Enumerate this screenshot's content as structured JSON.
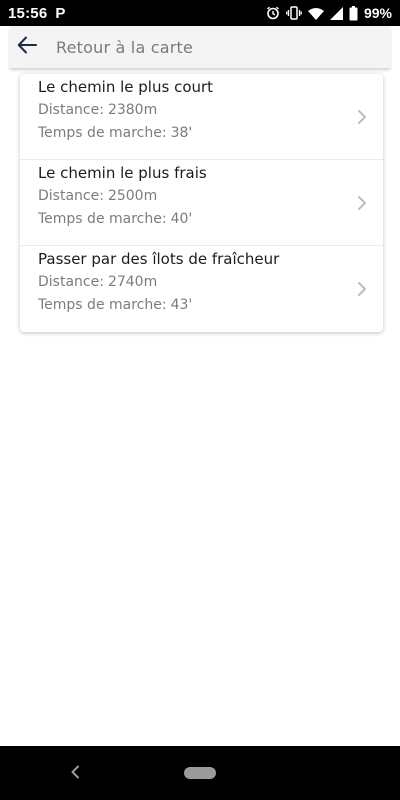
{
  "status_bar": {
    "time": "15:56",
    "app_icon_letter": "P",
    "battery_percent": "99%",
    "icons": [
      "alarm-icon",
      "vibrate-icon",
      "wifi-icon",
      "signal-icon",
      "battery-icon"
    ]
  },
  "header": {
    "back_icon": "arrow-left-icon",
    "title": "Retour à la carte"
  },
  "routes": [
    {
      "title": "Le chemin le plus court",
      "distance_label": "Distance:",
      "distance": "2380m",
      "time_label": "Temps de marche:",
      "time": "38'"
    },
    {
      "title": "Le chemin le plus frais",
      "distance_label": "Distance:",
      "distance": "2500m",
      "time_label": "Temps de marche:",
      "time": "40'"
    },
    {
      "title": "Passer par des îlots de fraîcheur",
      "distance_label": "Distance:",
      "distance": "2740m",
      "time_label": "Temps de marche:",
      "time": "43'"
    }
  ],
  "colors": {
    "header_bg": "#f4f4f4",
    "back_arrow": "#1f2a4a",
    "secondary_text": "#7c7c7c",
    "chevron": "#bdbdbd"
  }
}
